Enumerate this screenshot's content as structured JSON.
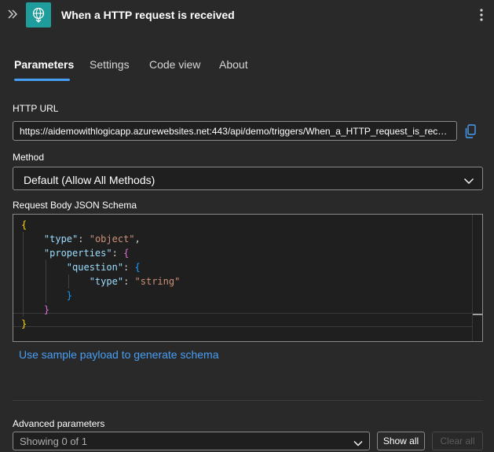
{
  "header": {
    "title": "When a HTTP request is received",
    "collapse_icon": "double-chevron-right-icon",
    "trigger_icon": "globe-request-icon",
    "more_icon": "more-vertical-icon",
    "accent_color": "#1f9c9c"
  },
  "tabs": [
    {
      "label": "Parameters",
      "active": true
    },
    {
      "label": "Settings",
      "active": false
    },
    {
      "label": "Code view",
      "active": false
    },
    {
      "label": "About",
      "active": false
    }
  ],
  "http_url": {
    "label": "HTTP URL",
    "value": "https://aidemowithlogicapp.azurewebsites.net:443/api/demo/triggers/When_a_HTTP_request_is_recei...",
    "copy_icon": "copy-icon"
  },
  "method": {
    "label": "Method",
    "selected": "Default (Allow All Methods)"
  },
  "schema": {
    "label": "Request Body JSON Schema",
    "lines": [
      [
        {
          "t": "{",
          "c": "b1"
        }
      ],
      [
        {
          "t": "    ",
          "c": "p"
        },
        {
          "t": "\"type\"",
          "c": "k"
        },
        {
          "t": ": ",
          "c": "p"
        },
        {
          "t": "\"object\"",
          "c": "s"
        },
        {
          "t": ",",
          "c": "p"
        }
      ],
      [
        {
          "t": "    ",
          "c": "p"
        },
        {
          "t": "\"properties\"",
          "c": "k"
        },
        {
          "t": ": ",
          "c": "p"
        },
        {
          "t": "{",
          "c": "b2"
        }
      ],
      [
        {
          "t": "        ",
          "c": "p"
        },
        {
          "t": "\"question\"",
          "c": "k"
        },
        {
          "t": ": ",
          "c": "p"
        },
        {
          "t": "{",
          "c": "b3"
        }
      ],
      [
        {
          "t": "            ",
          "c": "p"
        },
        {
          "t": "\"type\"",
          "c": "k"
        },
        {
          "t": ": ",
          "c": "p"
        },
        {
          "t": "\"string\"",
          "c": "s"
        }
      ],
      [
        {
          "t": "        ",
          "c": "p"
        },
        {
          "t": "}",
          "c": "b3"
        }
      ],
      [
        {
          "t": "    ",
          "c": "p"
        },
        {
          "t": "}",
          "c": "b2"
        }
      ],
      [
        {
          "t": "}",
          "c": "b1"
        }
      ]
    ]
  },
  "sample_link": "Use sample payload to generate schema",
  "advanced": {
    "label": "Advanced parameters",
    "selected": "Showing 0 of 1",
    "show_all": "Show all",
    "clear_all": "Clear all"
  }
}
